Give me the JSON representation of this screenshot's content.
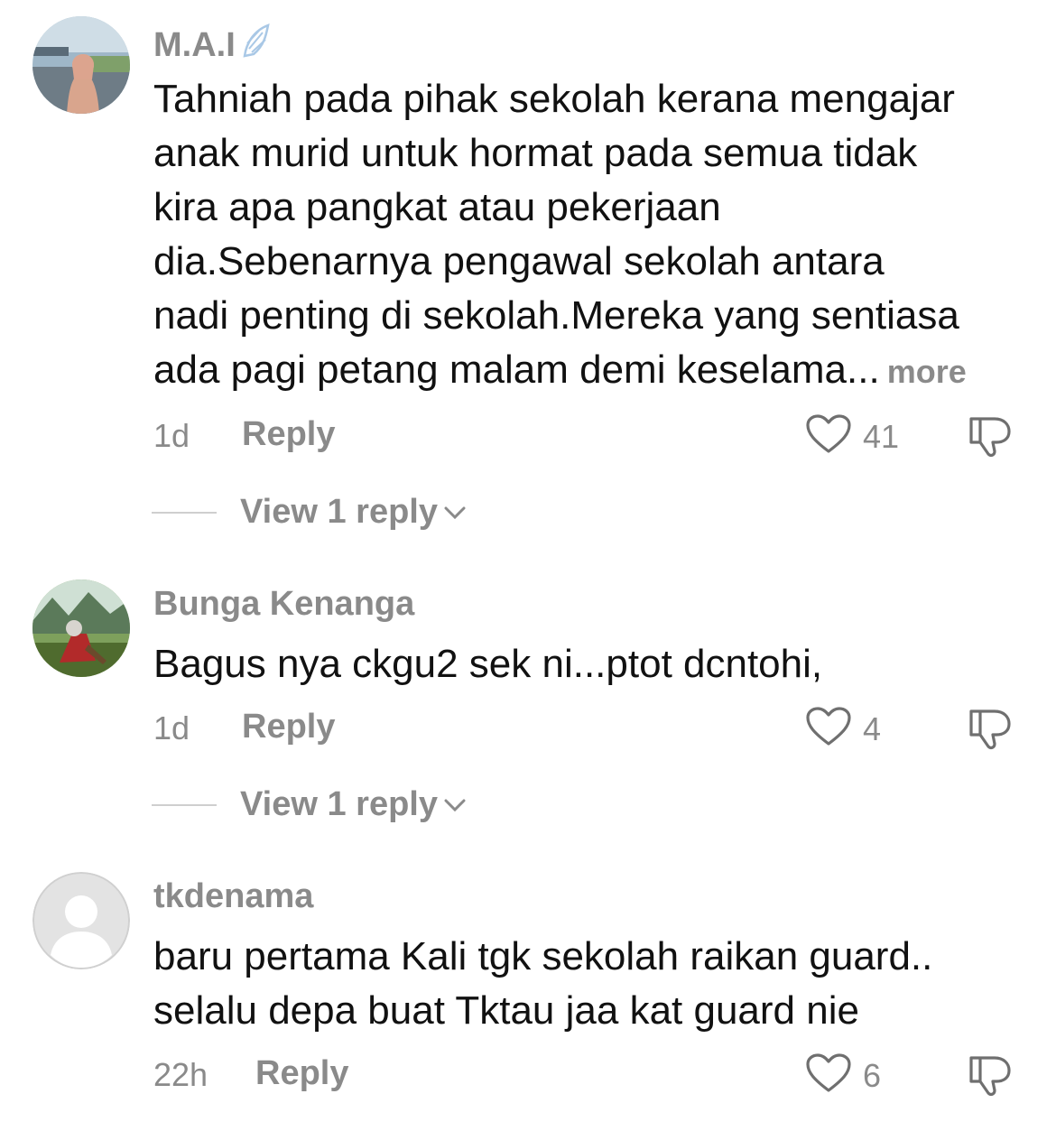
{
  "comments": [
    {
      "username": "M.A.I",
      "badge_icon": "wing-icon",
      "lines": [
        "Tahniah pada pihak sekolah kerana mengajar",
        "anak murid untuk hormat pada semua tidak",
        "kira apa pangkat atau pekerjaan",
        "dia.Sebenarnya pengawal sekolah antara",
        "nadi penting di sekolah.Mereka yang sentiasa",
        "ada pagi petang malam demi keselama..."
      ],
      "more_label": "more",
      "time": "1d",
      "reply_label": "Reply",
      "likes": "41",
      "view_replies_label": "View 1 reply"
    },
    {
      "username": "Bunga Kenanga",
      "lines": [
        "Bagus nya ckgu2 sek ni...ptot dcntohi,"
      ],
      "time": "1d",
      "reply_label": "Reply",
      "likes": "4",
      "view_replies_label": "View 1 reply"
    },
    {
      "username": "tkdenama",
      "lines": [
        "baru pertama Kali tgk sekolah raikan guard..",
        "selalu depa buat Tktau jaa kat guard nie"
      ],
      "time": "22h",
      "reply_label": "Reply",
      "likes": "6"
    }
  ],
  "icons": {
    "like": "heart-outline-icon",
    "dislike": "thumbs-down-icon",
    "expand": "chevron-down-icon"
  },
  "colors": {
    "text_primary": "#111111",
    "text_secondary": "#8a8a8a",
    "divider": "#cfcfcf",
    "background": "#ffffff"
  }
}
